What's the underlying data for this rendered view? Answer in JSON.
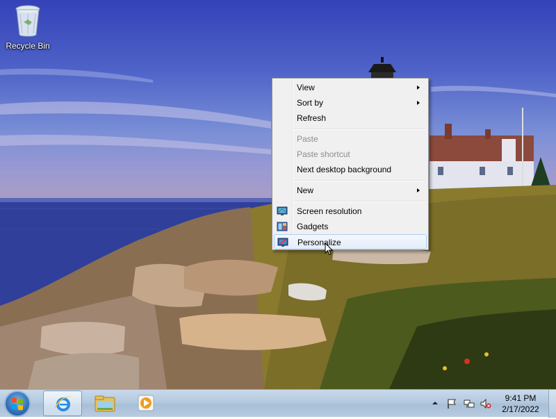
{
  "desktop": {
    "icons": [
      {
        "label": "Recycle Bin",
        "icon": "recycle-bin-icon"
      }
    ]
  },
  "context_menu": {
    "items": [
      {
        "label": "View",
        "submenu": true,
        "enabled": true
      },
      {
        "label": "Sort by",
        "submenu": true,
        "enabled": true
      },
      {
        "label": "Refresh",
        "enabled": true
      },
      {
        "label": "Paste",
        "enabled": false
      },
      {
        "label": "Paste shortcut",
        "enabled": false
      },
      {
        "label": "Next desktop background",
        "enabled": true
      },
      {
        "label": "New",
        "submenu": true,
        "enabled": true
      },
      {
        "label": "Screen resolution",
        "icon": "screen-resolution-icon",
        "enabled": true
      },
      {
        "label": "Gadgets",
        "icon": "gadgets-icon",
        "enabled": true
      },
      {
        "label": "Personalize",
        "icon": "personalize-icon",
        "enabled": true,
        "highlighted": true
      }
    ]
  },
  "taskbar": {
    "pinned": [
      {
        "icon": "internet-explorer-icon",
        "active": true
      },
      {
        "icon": "windows-explorer-icon",
        "active": false
      },
      {
        "icon": "media-player-icon",
        "active": false
      }
    ],
    "tray_icons": [
      "show-hidden-icons-icon",
      "action-center-flag-icon",
      "network-icon",
      "volume-muted-icon"
    ],
    "clock": {
      "time": "9:41 PM",
      "date": "2/17/2022"
    }
  },
  "colors": {
    "sky_top": "#3442b8",
    "sea": "#2f3f9a",
    "menu_bg": "#f0f0f0",
    "menu_highlight_border": "#aecff7",
    "taskbar": "#b4c9df"
  }
}
